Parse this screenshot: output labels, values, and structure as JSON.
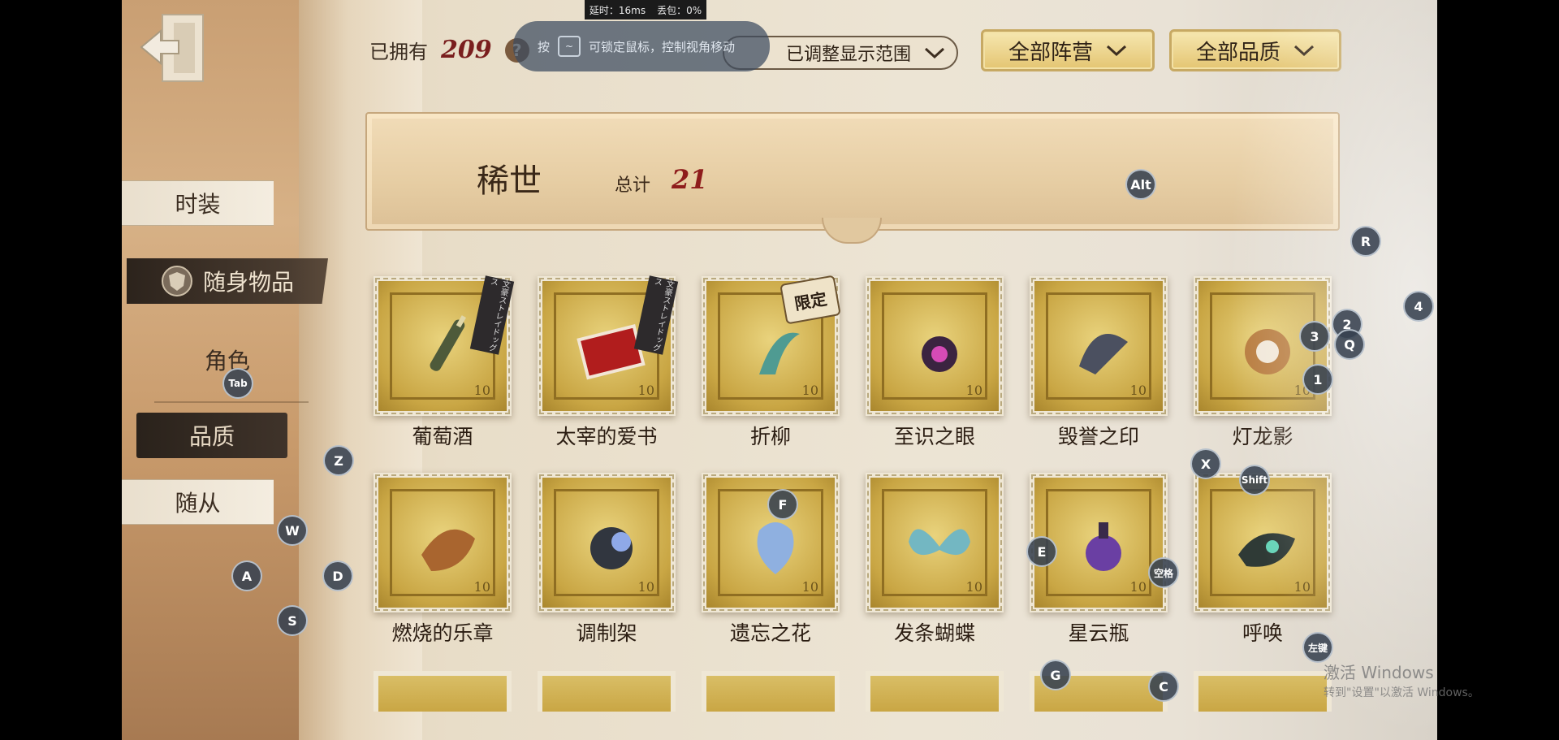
{
  "net": {
    "latency": "延时：16ms",
    "loss": "丢包：0%"
  },
  "lock_hint": {
    "prefix": "按",
    "key": "~",
    "text": "可锁定鼠标，控制视角移动"
  },
  "header": {
    "owned_label": "已拥有",
    "owned_count": "209",
    "help": "?"
  },
  "filters": {
    "scope": "已调整显示范围",
    "camp": "全部阵营",
    "quality": "全部品质"
  },
  "sidebar": {
    "fashion": "时装",
    "items": "随身物品",
    "role": "角色",
    "quality": "品质",
    "follower": "随从"
  },
  "banner": {
    "title": "稀世",
    "total_label": "总计",
    "total": "21"
  },
  "items": [
    {
      "name": "葡萄酒",
      "tag": "ribbon",
      "ribbon": "文豪ストレイドッグス"
    },
    {
      "name": "太宰的爱书",
      "tag": "ribbon",
      "ribbon": "文豪ストレイドッグス"
    },
    {
      "name": "折柳",
      "tag": "limited",
      "limited": "限定"
    },
    {
      "name": "至识之眼"
    },
    {
      "name": "毁誉之印"
    },
    {
      "name": "灯龙影"
    },
    {
      "name": "燃烧的乐章"
    },
    {
      "name": "调制架"
    },
    {
      "name": "遗忘之花"
    },
    {
      "name": "发条蝴蝶"
    },
    {
      "name": "星云瓶"
    },
    {
      "name": "呼唤"
    }
  ],
  "stamp_number": "10",
  "watermark": {
    "title": "激活 Windows",
    "sub": "转到\"设置\"以激活 Windows。"
  },
  "keys": {
    "alt": "Alt",
    "r": "R",
    "four": "4",
    "two": "2",
    "three": "3",
    "q": "Q",
    "one": "1",
    "tab": "Tab",
    "z": "Z",
    "x": "X",
    "shift": "Shift",
    "f": "F",
    "w": "W",
    "e": "E",
    "space": "空格",
    "a": "A",
    "d": "D",
    "s": "S",
    "left_click": "左键",
    "g": "G",
    "c": "C"
  },
  "colors": {
    "count_red": "#7a1e1e",
    "stamp_gold": "#c9a644",
    "dark_tab": "#2c231c"
  }
}
